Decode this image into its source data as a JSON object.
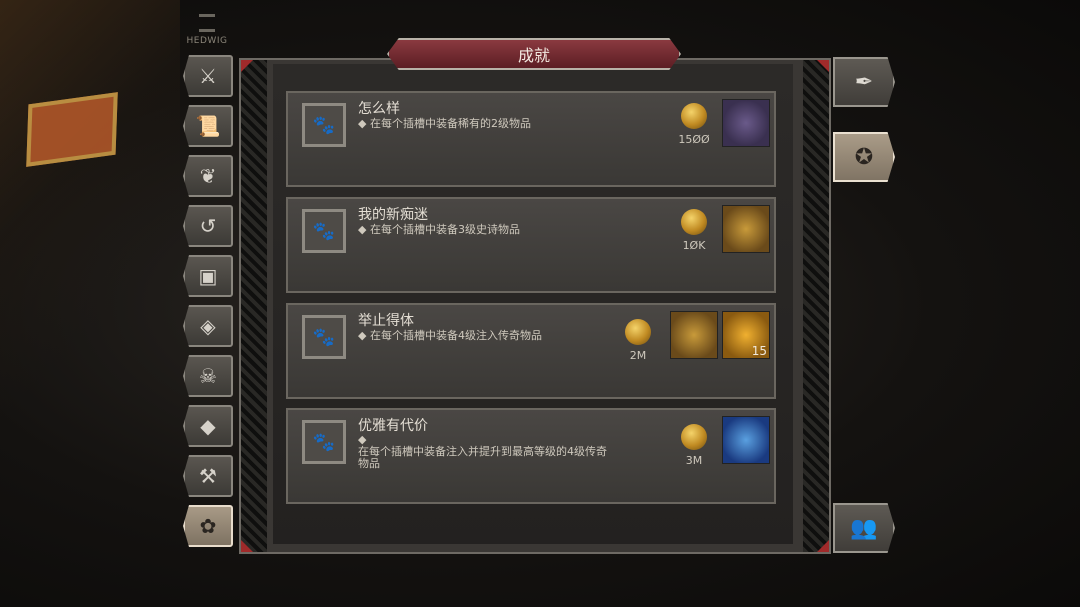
{
  "hud": {
    "player_name": "HEDWIG"
  },
  "window": {
    "title": "成就"
  },
  "categories": [
    {
      "icon": "sword-icon",
      "glyph": "⚔"
    },
    {
      "icon": "scroll-icon",
      "glyph": "📜"
    },
    {
      "icon": "wings-icon",
      "glyph": "❦"
    },
    {
      "icon": "hook-icon",
      "glyph": "↺"
    },
    {
      "icon": "chest-icon",
      "glyph": "▣"
    },
    {
      "icon": "gems-icon",
      "glyph": "◈"
    },
    {
      "icon": "demon-skull-icon",
      "glyph": "☠"
    },
    {
      "icon": "diamond-icon",
      "glyph": "◆"
    },
    {
      "icon": "hammers-icon",
      "glyph": "⚒"
    },
    {
      "icon": "paw-icon",
      "glyph": "✿"
    }
  ],
  "achievements": [
    {
      "name": "怎么样",
      "desc": "◆ 在每个插槽中装备稀有的2级物品",
      "gold": "15ØØ",
      "rewards": [
        {
          "icon": "purple-item-icon",
          "qty": ""
        }
      ]
    },
    {
      "name": "我的新痴迷",
      "desc": "◆ 在每个插槽中装备3级史诗物品",
      "gold": "1ØK",
      "rewards": [
        {
          "icon": "gold-cube-icon",
          "qty": ""
        }
      ]
    },
    {
      "name": "举止得体",
      "desc": "◆ 在每个插槽中装备4级注入传奇物品",
      "gold": "2M",
      "rewards": [
        {
          "icon": "gold-cube-icon",
          "qty": ""
        },
        {
          "icon": "amber-drop-icon",
          "qty": "15"
        }
      ]
    },
    {
      "name": "优雅有代价",
      "desc_bullet": "◆",
      "desc": "在每个插槽中装备注入并提升到最高等级的4级传奇物品",
      "gold": "3M",
      "rewards": [
        {
          "icon": "blue-rune-icon",
          "qty": ""
        }
      ]
    }
  ],
  "side_buttons": [
    {
      "icon": "quill-icon",
      "glyph": "✒"
    },
    {
      "icon": "laurel-star-icon",
      "glyph": "✪"
    },
    {
      "icon": "group-icon",
      "glyph": "👥"
    }
  ]
}
